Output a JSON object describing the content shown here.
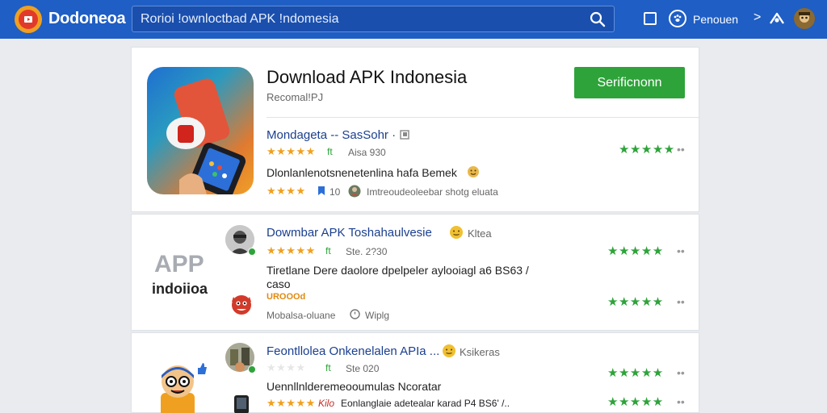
{
  "header": {
    "brand": "Dodoneoa",
    "search_value": "Rorioi !ownloctbad APK !ndomesia",
    "user_label": "Penouen",
    "chevron": ">"
  },
  "app": {
    "title": "Download APK Indonesia",
    "subtitle": "Recomal!PJ",
    "install_label": "Serificnonn"
  },
  "reviews": [
    {
      "title": "Mondageta -- SasSohr ·",
      "stars": "★★★★★",
      "stars_suffix": "ft",
      "meta": "Aisa 930",
      "body": "Dlonlanlenotsnenetenlina hafa Bemek",
      "stars2": "★★★★",
      "stars2_suffix": "10",
      "meta2": "Imtreoudeoleebar shotg eluata",
      "right_stars": "★★★★★",
      "right_dots": "••"
    },
    {
      "title": "Dowmbar APK Toshahaulvesie",
      "title_tail": "Kltea",
      "stars": "★★★★★",
      "stars_suffix": "ft",
      "meta": "Ste. 2?30",
      "body": "Tiretlane Dere daolore dpelpeler aylooiagl a6 BS63 / caso",
      "tag": "UROOOd",
      "meta2": "Mobalsa-oluane",
      "meta3": "Wiplg",
      "right_stars": "★★★★★",
      "right_dots": "••",
      "right_stars_2": "★★★★★",
      "right_dots_2": "••"
    },
    {
      "title": "Feontllolea Onkenelalen APIa ...",
      "title_tail": "Ksikeras",
      "stars": "★★★★",
      "stars_suffix": "ft",
      "meta": "Ste 020",
      "body": "Uennllnlderemeooumulas Ncoratar",
      "stars2": "★★★★★",
      "stars2_prefix": "Kilo",
      "meta2": "Eonlanglaie adetealar karad P4 BS6' /..",
      "right_stars": "★★★★★",
      "right_dots": "••",
      "right_stars_2": "★★★★★",
      "right_dots_2": "••"
    }
  ],
  "sidebar_ghost": {
    "word": "APP",
    "name": "indoiioa"
  },
  "colors": {
    "topbar": "#1f5ec4",
    "install": "#2ea33a",
    "link": "#1a3f8f",
    "star_gold": "#f0a020",
    "star_green": "#2ea33a"
  },
  "icons": [
    "play-logo-icon",
    "search-icon",
    "square-icon",
    "paw-icon",
    "chevron-right-icon",
    "share-icon",
    "avatar"
  ]
}
